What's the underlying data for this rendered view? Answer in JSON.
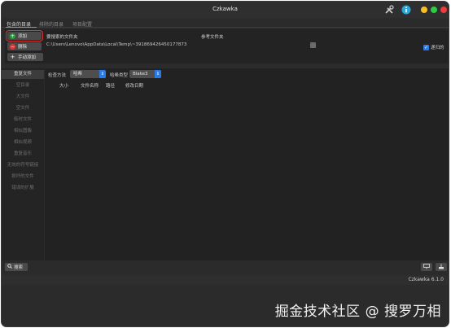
{
  "window": {
    "title": "Czkawka",
    "toolbar_icons": [
      "tools-icon",
      "info-icon"
    ],
    "traffic_lights": {
      "minimize": "#f5c026",
      "maximize": "#2ecc40",
      "close": "#ee3b3b"
    }
  },
  "tabs": [
    {
      "label": "包含的目录",
      "active": true
    },
    {
      "label": "排除的目录",
      "active": false
    },
    {
      "label": "项目配置",
      "active": false
    }
  ],
  "directories": {
    "add_label": "添加",
    "remove_label": "删除",
    "manual_add_label": "手动添加",
    "column_search": "要搜索的文件夹",
    "column_reference": "参考文件夹",
    "path": "C:\\Users\\Lenovo\\AppData\\Local\\Temp\\~391869426450177873",
    "recursive_label": "递归的",
    "recursive_checked": true
  },
  "nav": {
    "items": [
      {
        "label": "重复文件",
        "active": true
      },
      {
        "label": "空目录"
      },
      {
        "label": "大文件"
      },
      {
        "label": "空文件"
      },
      {
        "label": "临时文件"
      },
      {
        "label": "相似图像"
      },
      {
        "label": "相似视频"
      },
      {
        "label": "重复音乐"
      },
      {
        "label": "无效的符号链接"
      },
      {
        "label": "损坏的文件"
      },
      {
        "label": "错误的扩展"
      }
    ]
  },
  "main": {
    "check_method_label": "检查方法",
    "check_method_value": "哈希",
    "hash_type_label": "哈希类型",
    "hash_type_value": "Blake3",
    "columns": [
      "大小",
      "文件名称",
      "路径",
      "修改日期"
    ]
  },
  "bottom": {
    "search_label": "搜索",
    "right_icons": [
      "select-icon",
      "delete-icon"
    ]
  },
  "status": {
    "version": "Czkawka 6.1.0"
  },
  "watermark": "掘金技术社区 @ 搜罗万相"
}
